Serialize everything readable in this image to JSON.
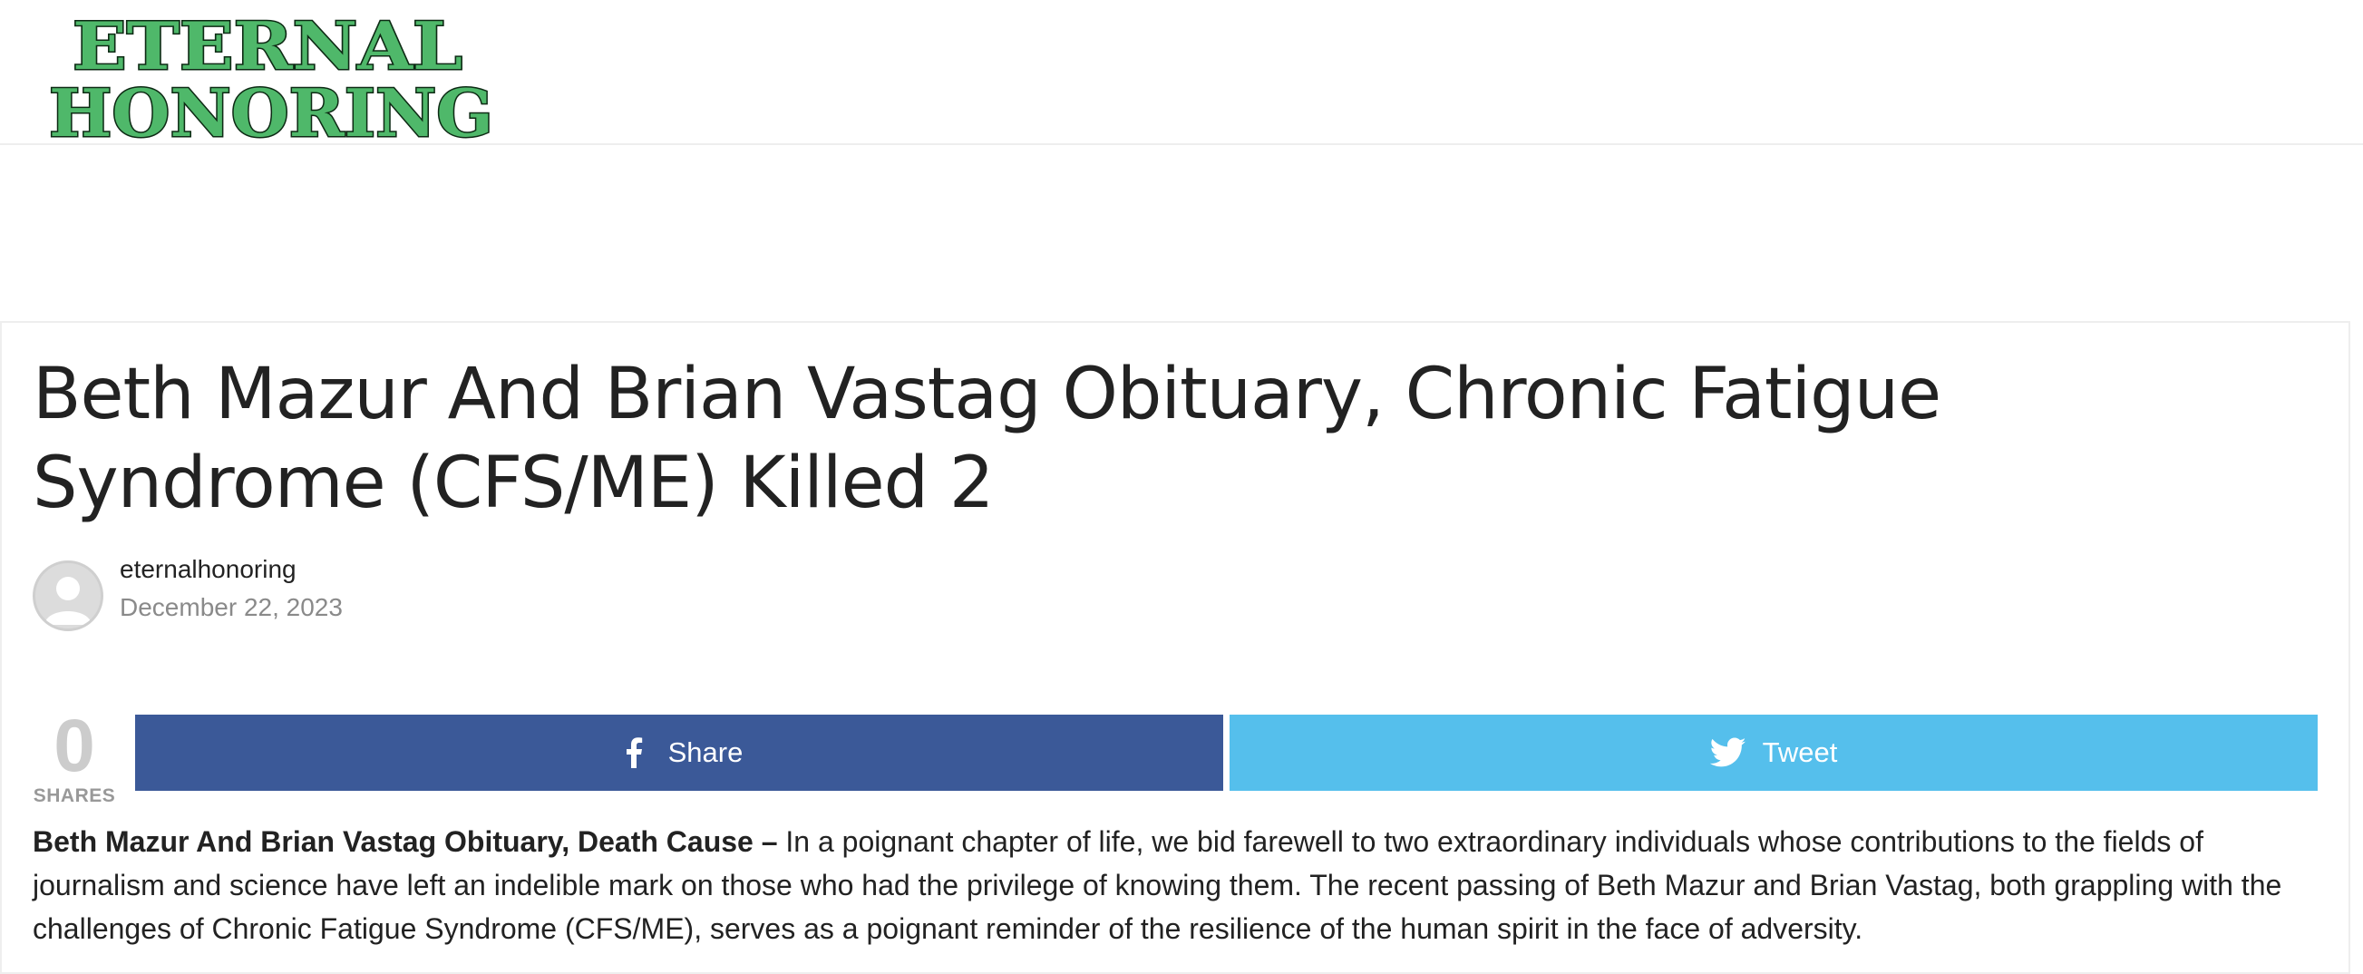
{
  "site": {
    "logo_line1": "ETERNAL",
    "logo_line2": "HONORING",
    "brand_color": "#4fb86a"
  },
  "article": {
    "title": "Beth Mazur And Brian Vastag Obituary, Chronic Fatigue Syndrome (CFS/ME) Killed 2",
    "author": "eternalhonoring",
    "date": "December 22, 2023",
    "avatar_icon": "user-avatar-icon",
    "shares": {
      "count": "0",
      "label": "SHARES"
    },
    "share_buttons": {
      "facebook_label": "Share",
      "facebook_icon": "facebook-icon",
      "facebook_color": "#3b5998",
      "twitter_label": "Tweet",
      "twitter_icon": "twitter-icon",
      "twitter_color": "#55bfec"
    },
    "excerpt_lead": "Beth Mazur And Brian Vastag Obituary, Death Cause –",
    "excerpt_body": " In a poignant chapter of life, we bid farewell to two extraordinary individuals whose contributions to the fields of journalism and science have left an indelible mark on those who had the privilege of knowing them. The recent passing of Beth Mazur and Brian Vastag, both grappling with the challenges of Chronic Fatigue Syndrome (CFS/ME), serves as a poignant reminder of the resilience of the human spirit in the face of adversity."
  }
}
